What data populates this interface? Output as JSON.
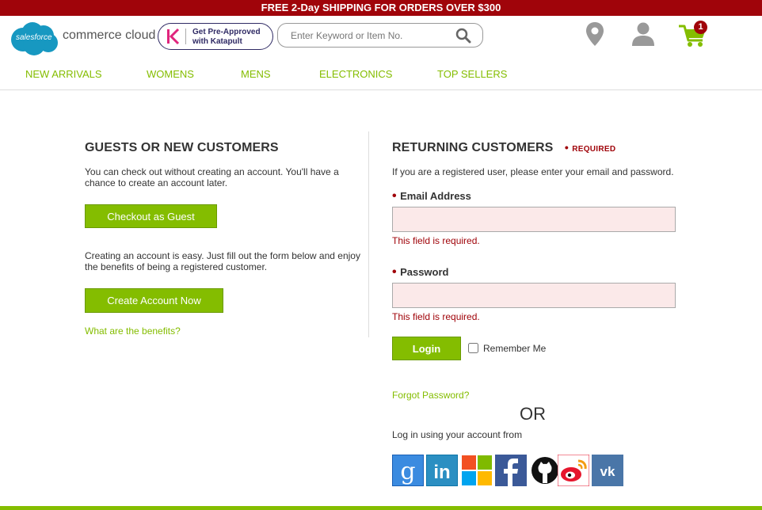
{
  "promo": {
    "text": "FREE 2-Day SHIPPING FOR ORDERS OVER $300"
  },
  "header": {
    "logo_cloud_text": "salesforce",
    "logo_text": "commerce cloud",
    "katapult_line1": "Get Pre-Approved",
    "katapult_line2": "with Katapult",
    "search_placeholder": "Enter Keyword or Item No.",
    "cart_count": "1",
    "colors": {
      "brand_red": "#a0040a",
      "accent_green": "#84bd00",
      "salesforce_blue": "#1798c1"
    }
  },
  "nav": [
    "NEW ARRIVALS",
    "WOMENS",
    "MENS",
    "ELECTRONICS",
    "TOP SELLERS"
  ],
  "guest": {
    "title": "GUESTS OR NEW CUSTOMERS",
    "intro": "You can check out without creating an account. You'll have a chance to create an account later.",
    "checkout_label": "Checkout as Guest",
    "create_intro": "Creating an account is easy. Just fill out the form below and enjoy the benefits of being a registered customer.",
    "create_label": "Create Account Now",
    "benefits_link": "What are the benefits?"
  },
  "returning": {
    "title": "RETURNING CUSTOMERS",
    "required_label": "REQUIRED",
    "intro": "If you are a registered user, please enter your email and password.",
    "email_label": "Email Address",
    "email_value": "",
    "email_error": "This field is required.",
    "password_label": "Password",
    "password_value": "",
    "password_error": "This field is required.",
    "login_label": "Login",
    "remember_label": "Remember Me",
    "remember_checked": false,
    "forgot_link": "Forgot Password?",
    "or_text": "OR",
    "social_intro": "Log in using your account from",
    "social": [
      "google-icon",
      "linkedin-icon",
      "microsoft-icon",
      "facebook-icon",
      "github-icon",
      "weibo-icon",
      "vk-icon"
    ]
  }
}
